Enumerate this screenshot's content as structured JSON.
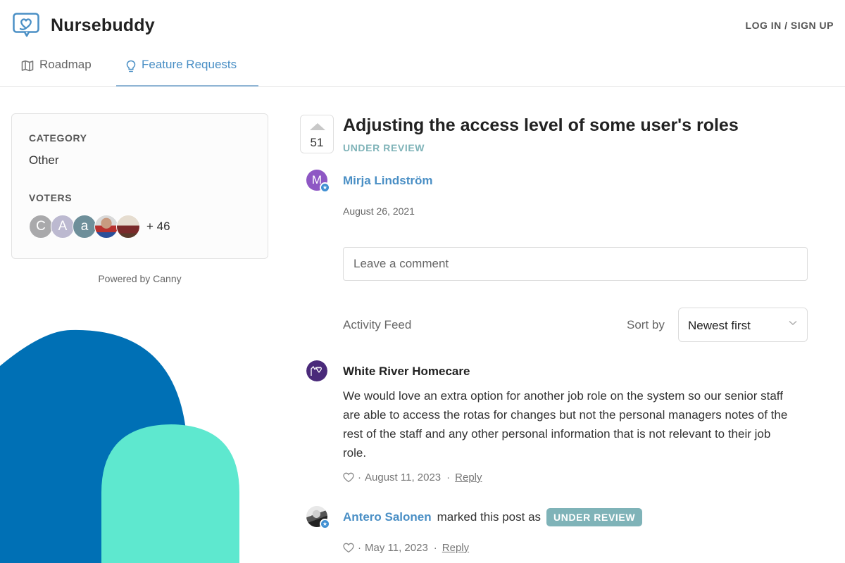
{
  "header": {
    "brand": "Nursebuddy",
    "login_label": "LOG IN / SIGN UP",
    "logo_icon": "heart-chat-icon",
    "tabs": [
      {
        "label": "Roadmap",
        "icon": "map-icon",
        "active": false
      },
      {
        "label": "Feature Requests",
        "icon": "lightbulb-icon",
        "active": true
      }
    ]
  },
  "sidebar": {
    "category_label": "CATEGORY",
    "category_value": "Other",
    "voters_label": "VOTERS",
    "voters": [
      {
        "initial": "C",
        "color": "#a9a9ab"
      },
      {
        "initial": "A",
        "color": "#bcb9d0"
      },
      {
        "initial": "a",
        "color": "#6e8f9a"
      },
      {
        "initial": "",
        "color": "#8a5a4a",
        "photo": true
      },
      {
        "initial": "",
        "color": "#7a4a3a",
        "photo": true
      }
    ],
    "voters_more": "+ 46",
    "powered_by": "Powered by Canny"
  },
  "post": {
    "vote_count": "51",
    "title": "Adjusting the access level of some user's roles",
    "status": "UNDER REVIEW",
    "author": {
      "name": "Mirja Lindström",
      "initial": "M",
      "color": "#8e57c4"
    },
    "date": "August 26, 2021"
  },
  "comment_box": {
    "placeholder": "Leave a comment"
  },
  "feed": {
    "label": "Activity Feed",
    "sort_label": "Sort by",
    "sort_value": "Newest first",
    "items": [
      {
        "author": "White River Homecare",
        "avatar_color": "#4a2a7a",
        "body": "We would love an extra option for another job role on the system so our senior staff are able to access the rotas for changes but not the personal managers notes of the rest of the staff and any other personal information that is not relevant to their job role.",
        "separator": "·",
        "date": "August 11, 2023",
        "reply_label": "Reply"
      },
      {
        "author": "Antero Salonen",
        "action_text": "marked this post as",
        "status": "UNDER REVIEW",
        "separator": "·",
        "date": "May 11, 2023",
        "reply_label": "Reply"
      }
    ]
  },
  "colors": {
    "accent": "#4a8fc5",
    "status": "#7fb3b8",
    "deco_blue": "#0070b5",
    "deco_teal": "#5ee8cf"
  }
}
